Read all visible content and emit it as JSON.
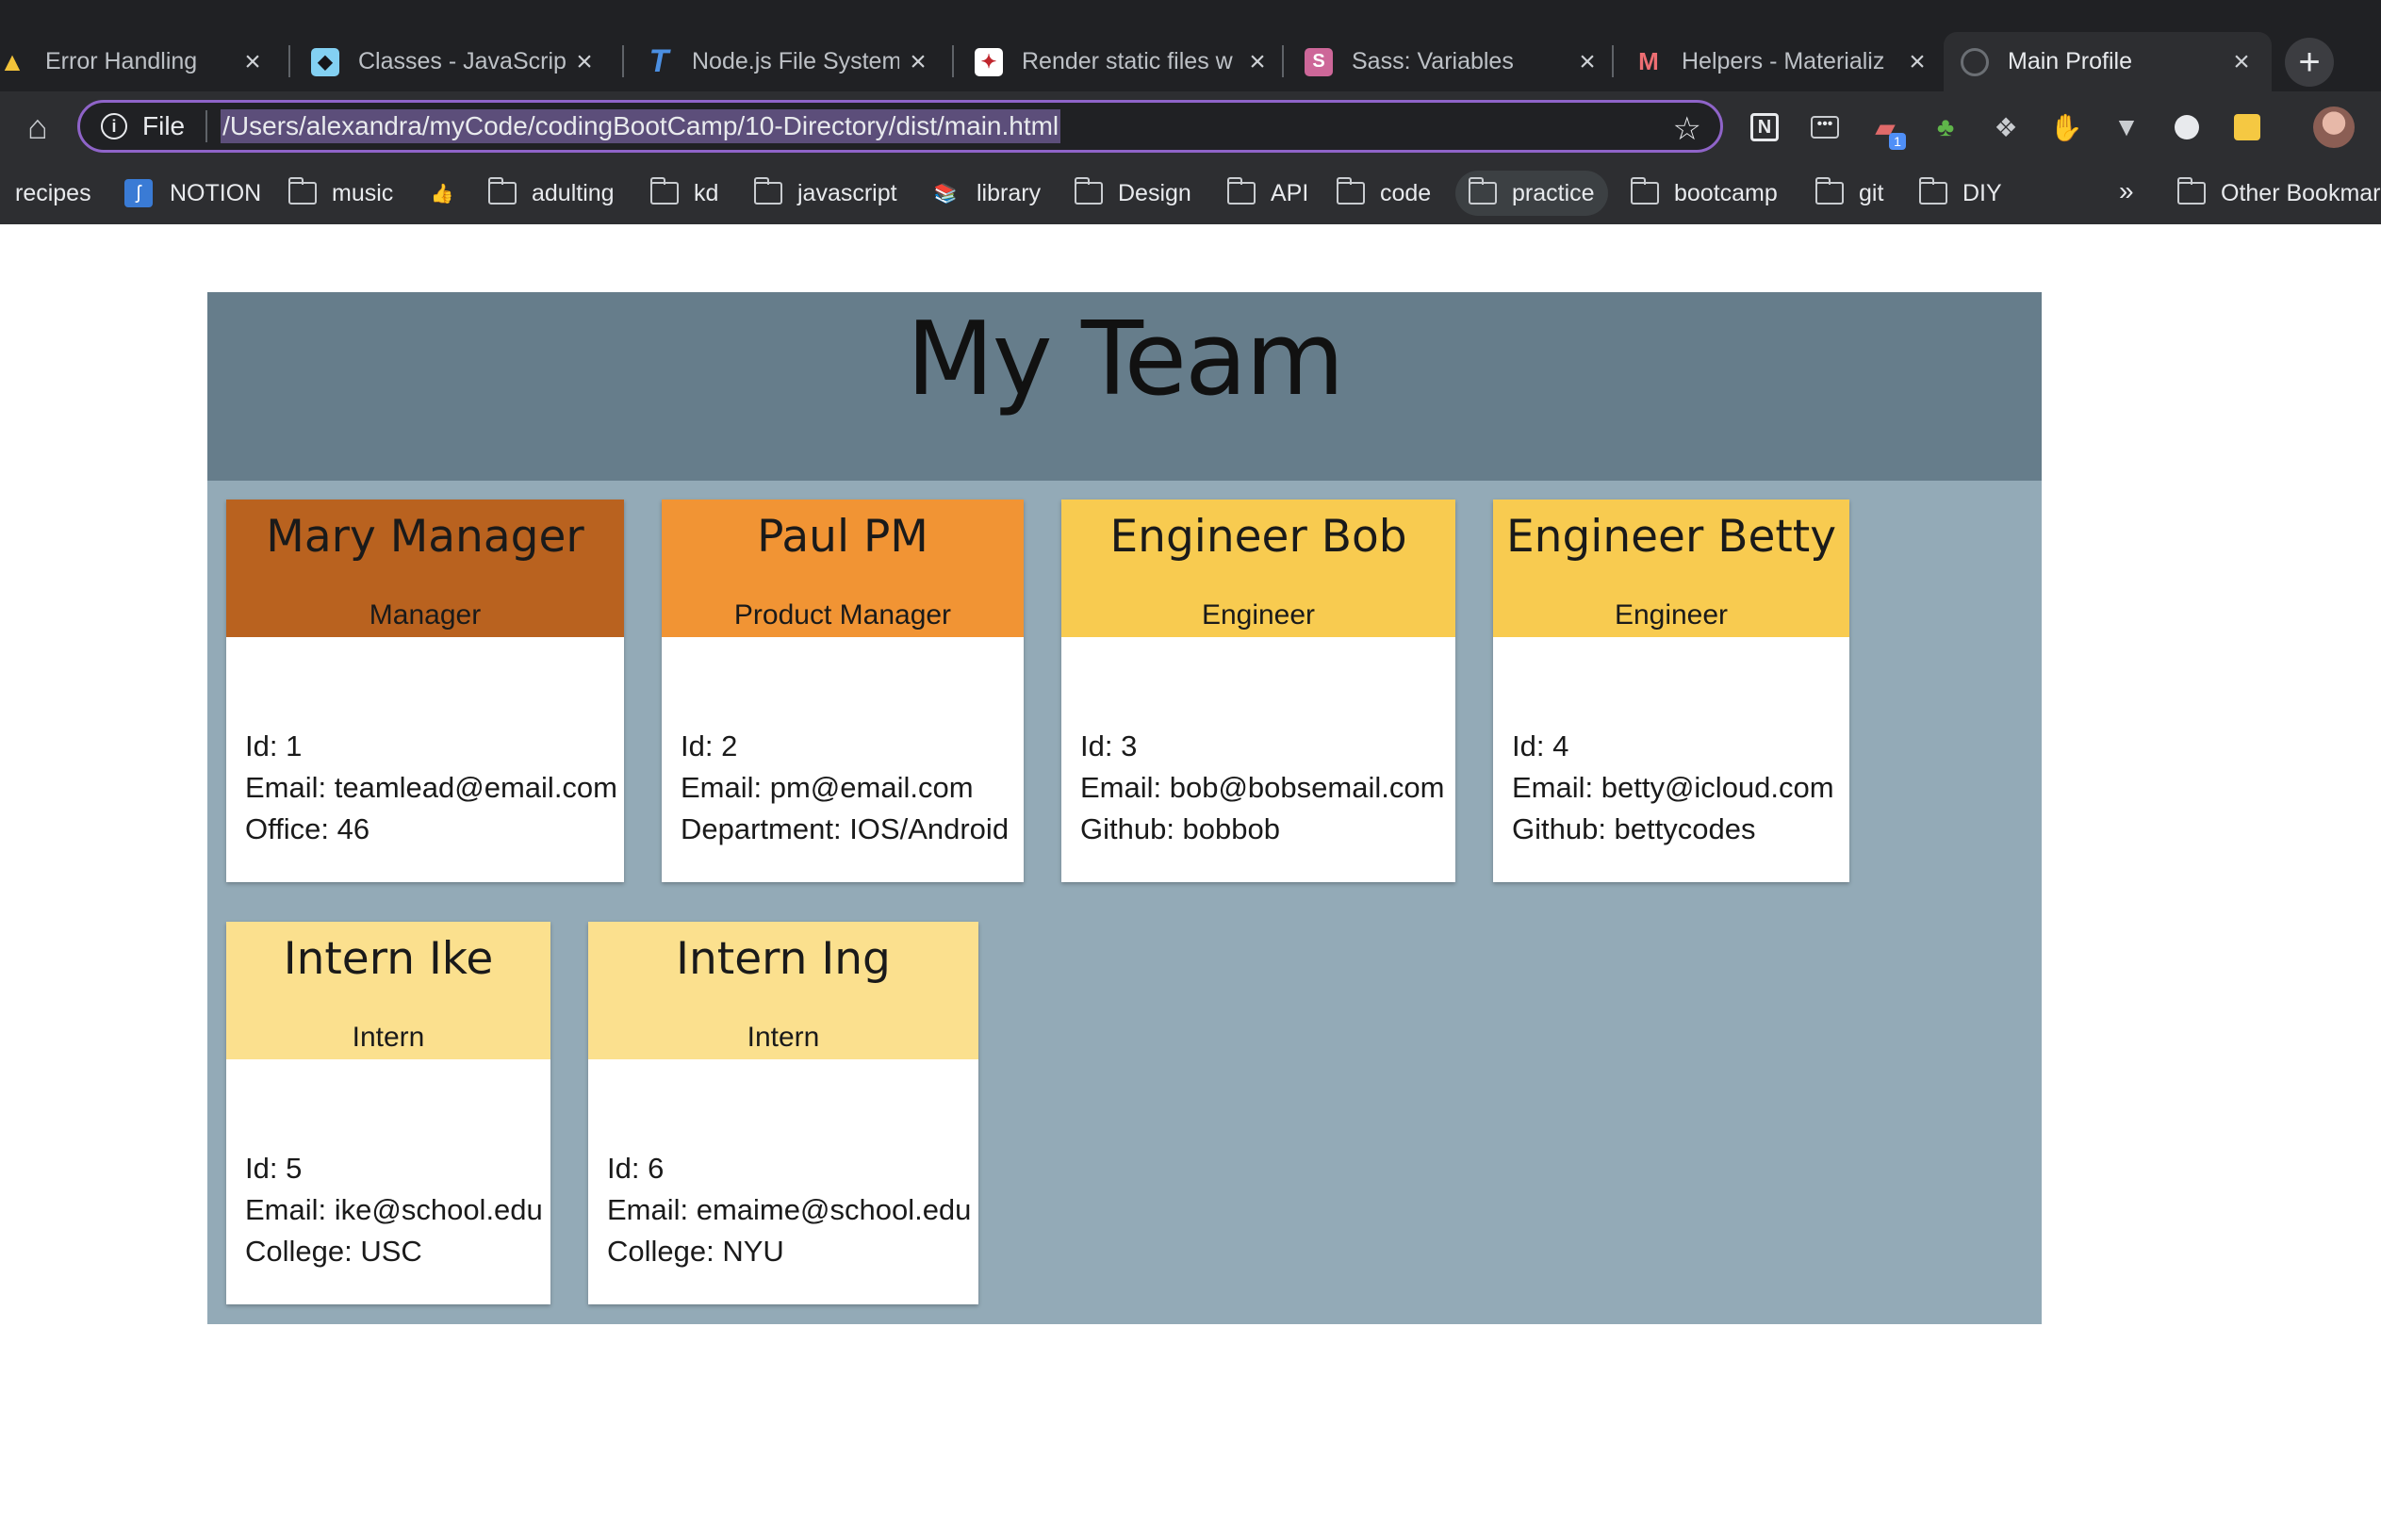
{
  "browser": {
    "tabs": [
      {
        "label": "Error Handling",
        "icon": "warning-triangle-icon"
      },
      {
        "label": "Classes - JavaScrip",
        "icon": "mdn-icon"
      },
      {
        "label": "Node.js File System",
        "icon": "tutorialspoint-icon"
      },
      {
        "label": "Render static files w",
        "icon": "express-icon"
      },
      {
        "label": "Sass: Variables",
        "icon": "sass-icon"
      },
      {
        "label": "Helpers - Materializ",
        "icon": "materialize-icon"
      },
      {
        "label": "Main Profile",
        "icon": "globe-icon"
      }
    ],
    "address": {
      "scheme": "File",
      "url": "/Users/alexandra/myCode/codingBootCamp/10-Directory/dist/main.html"
    },
    "bookmarks": [
      {
        "label": "recipes"
      },
      {
        "label": "NOTION"
      },
      {
        "label": "music"
      },
      {
        "label": ""
      },
      {
        "label": "adulting"
      },
      {
        "label": "kd"
      },
      {
        "label": "javascript"
      },
      {
        "label": "library"
      },
      {
        "label": "Design"
      },
      {
        "label": "API"
      },
      {
        "label": "code"
      },
      {
        "label": "practice"
      },
      {
        "label": "bootcamp"
      },
      {
        "label": "git"
      },
      {
        "label": "DIY"
      }
    ],
    "overflow": "»",
    "other_bookmarks": "Other Bookmar",
    "colors": {
      "tabstrip": "#202124",
      "toolbar": "#2d2e31",
      "omnibox_border": "#8f64c9"
    }
  },
  "page": {
    "title": "My Team",
    "colors": {
      "jumbotron": "#667d8b",
      "container": "#93aab7"
    },
    "cards": [
      {
        "name": "Mary Manager",
        "role": "Manager",
        "color": "#b9621f",
        "lines": [
          "Id: 1",
          "Email: teamlead@email.com",
          "Office: 46"
        ]
      },
      {
        "name": "Paul PM",
        "role": "Product Manager",
        "color": "#f19434",
        "lines": [
          "Id: 2",
          "Email: pm@email.com",
          "Department: IOS/Android"
        ]
      },
      {
        "name": "Engineer Bob",
        "role": "Engineer",
        "color": "#f8cb50",
        "lines": [
          "Id: 3",
          "Email: bob@bobsemail.com",
          "Github: bobbob"
        ]
      },
      {
        "name": "Engineer Betty",
        "role": "Engineer",
        "color": "#f8cb50",
        "lines": [
          "Id: 4",
          "Email: betty@icloud.com",
          "Github: bettycodes"
        ]
      },
      {
        "name": "Intern Ike",
        "role": "Intern",
        "color": "#fbe08e",
        "lines": [
          "Id: 5",
          "Email: ike@school.edu",
          "College: USC"
        ]
      },
      {
        "name": "Intern Ing",
        "role": "Intern",
        "color": "#fbe08e",
        "lines": [
          "Id: 6",
          "Email: emaime@school.edu",
          "College: NYU"
        ]
      }
    ]
  }
}
